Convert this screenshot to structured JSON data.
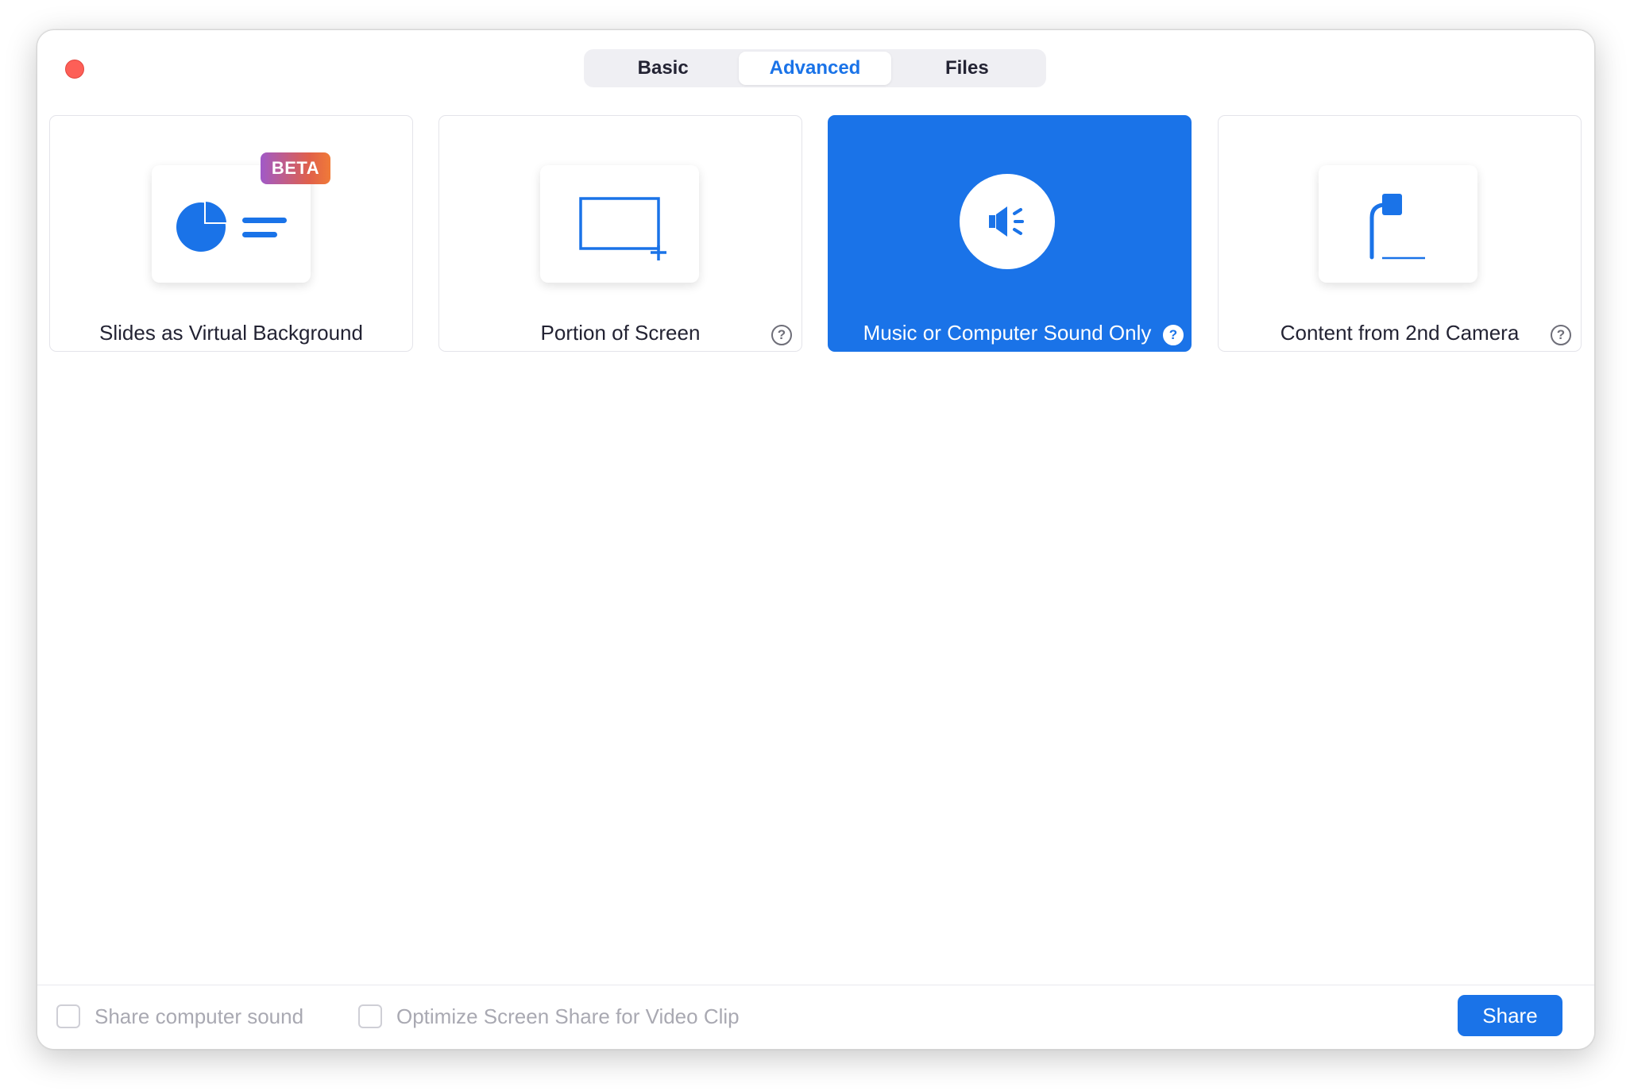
{
  "tabs": {
    "basic": "Basic",
    "advanced": "Advanced",
    "files": "Files",
    "active": "Advanced"
  },
  "cards": [
    {
      "label": "Slides as Virtual Background",
      "badge": "BETA",
      "icon": "slides-pie-icon",
      "selected": false
    },
    {
      "label": "Portion of Screen",
      "icon": "portion-screen-icon",
      "help": "?",
      "selected": false
    },
    {
      "label": "Music or Computer Sound Only",
      "icon": "speaker-icon",
      "help": "?",
      "selected": true
    },
    {
      "label": "Content from 2nd Camera",
      "icon": "document-camera-icon",
      "help": "?",
      "selected": false
    }
  ],
  "footer": {
    "share_sound_label": "Share computer sound",
    "share_sound_checked": false,
    "optimize_label": "Optimize Screen Share for Video Clip",
    "optimize_checked": false,
    "share_button": "Share"
  },
  "colors": {
    "accent": "#1a73e8",
    "close": "#fd5f57",
    "beta_gradient": [
      "#a05ac8",
      "#f07a38"
    ]
  }
}
